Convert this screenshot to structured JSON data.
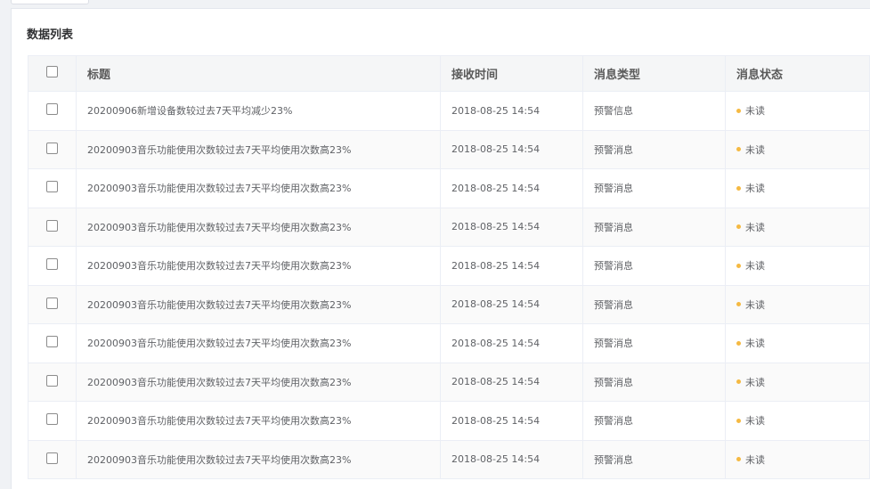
{
  "panel": {
    "title": "数据列表"
  },
  "table": {
    "headers": {
      "title": "标题",
      "time": "接收时间",
      "type": "消息类型",
      "status": "消息状态"
    },
    "rows": [
      {
        "title": "20200906新增设备数较过去7天平均减少23%",
        "time": "2018-08-25 14:54",
        "type": "预警信息",
        "status": "未读"
      },
      {
        "title": "20200903音乐功能使用次数较过去7天平均使用次数高23%",
        "time": "2018-08-25 14:54",
        "type": "预警消息",
        "status": "未读"
      },
      {
        "title": "20200903音乐功能使用次数较过去7天平均使用次数高23%",
        "time": "2018-08-25 14:54",
        "type": "预警消息",
        "status": "未读"
      },
      {
        "title": "20200903音乐功能使用次数较过去7天平均使用次数高23%",
        "time": "2018-08-25 14:54",
        "type": "预警消息",
        "status": "未读"
      },
      {
        "title": "20200903音乐功能使用次数较过去7天平均使用次数高23%",
        "time": "2018-08-25 14:54",
        "type": "预警消息",
        "status": "未读"
      },
      {
        "title": "20200903音乐功能使用次数较过去7天平均使用次数高23%",
        "time": "2018-08-25 14:54",
        "type": "预警消息",
        "status": "未读"
      },
      {
        "title": "20200903音乐功能使用次数较过去7天平均使用次数高23%",
        "time": "2018-08-25 14:54",
        "type": "预警消息",
        "status": "未读"
      },
      {
        "title": "20200903音乐功能使用次数较过去7天平均使用次数高23%",
        "time": "2018-08-25 14:54",
        "type": "预警消息",
        "status": "未读"
      },
      {
        "title": "20200903音乐功能使用次数较过去7天平均使用次数高23%",
        "time": "2018-08-25 14:54",
        "type": "预警消息",
        "status": "未读"
      },
      {
        "title": "20200903音乐功能使用次数较过去7天平均使用次数高23%",
        "time": "2018-08-25 14:54",
        "type": "预警消息",
        "status": "未读"
      }
    ]
  },
  "colors": {
    "unread_dot": "#f5b942",
    "header_bg": "#f5f6f7",
    "border": "#ebeef5"
  }
}
